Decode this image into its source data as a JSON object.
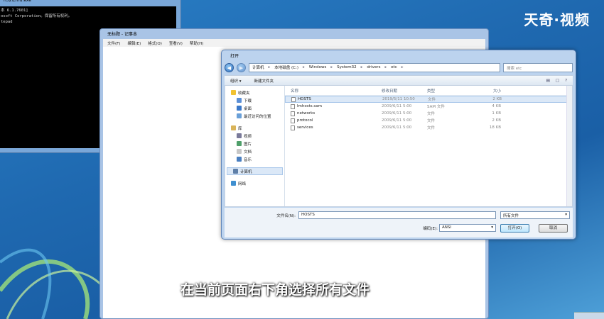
{
  "watermark": "天奇·视频",
  "subtitle": "在当前页面右下角选择所有文件",
  "cmd": {
    "title": "n32\\cmd.exe",
    "lines": [
      "本 6.1.7601]",
      "osoft Corporation。保留所有权利。",
      "",
      "tepad"
    ]
  },
  "notepad": {
    "title": "无标题 - 记事本",
    "menu": [
      "文件(F)",
      "编辑(E)",
      "格式(O)",
      "查看(V)",
      "帮助(H)"
    ]
  },
  "dialog": {
    "title": "打开",
    "address": [
      "计算机",
      "本地磁盘 (C:)",
      "Windows",
      "System32",
      "drivers",
      "etc"
    ],
    "search_placeholder": "搜索 etc",
    "toolbar": {
      "organize": "组织 ▾",
      "new_folder": "新建文件夹"
    },
    "nav": [
      {
        "label": "收藏夹",
        "icon": "star-icon",
        "sub": false
      },
      {
        "label": "下载",
        "icon": "download-folder-icon",
        "sub": true
      },
      {
        "label": "桌面",
        "icon": "desktop-icon",
        "sub": true
      },
      {
        "label": "最近访问的位置",
        "icon": "recent-places-icon",
        "sub": true
      },
      {
        "gap": true
      },
      {
        "label": "库",
        "icon": "library-icon",
        "sub": false
      },
      {
        "label": "视频",
        "icon": "video-icon",
        "sub": true
      },
      {
        "label": "图片",
        "icon": "picture-icon",
        "sub": true
      },
      {
        "label": "文档",
        "icon": "document-icon",
        "sub": true
      },
      {
        "label": "音乐",
        "icon": "music-icon",
        "sub": true
      },
      {
        "gap": true
      },
      {
        "label": "计算机",
        "icon": "computer-icon",
        "sub": false,
        "sel": true
      },
      {
        "gap": true
      },
      {
        "label": "网络",
        "icon": "network-icon",
        "sub": false
      }
    ],
    "columns": [
      "名称",
      "修改日期",
      "类型",
      "大小"
    ],
    "files": [
      {
        "name": "HOSTS",
        "date": "2019/5/11 10:50",
        "type": "文件",
        "size": "2 KB",
        "sel": true
      },
      {
        "name": "lmhosts.sam",
        "date": "2009/6/11 5:00",
        "type": "SAM 文件",
        "size": "4 KB"
      },
      {
        "name": "networks",
        "date": "2009/6/11 5:00",
        "type": "文件",
        "size": "1 KB"
      },
      {
        "name": "protocol",
        "date": "2009/6/11 5:00",
        "type": "文件",
        "size": "2 KB"
      },
      {
        "name": "services",
        "date": "2009/6/11 5:00",
        "type": "文件",
        "size": "18 KB"
      }
    ],
    "filename_label": "文件名(N):",
    "filename_value": "HOSTS",
    "filetype_value": "所有文件",
    "encoding_label": "编码(E):",
    "encoding_value": "ANSI",
    "open_label": "打开(O)",
    "cancel_label": "取消"
  }
}
